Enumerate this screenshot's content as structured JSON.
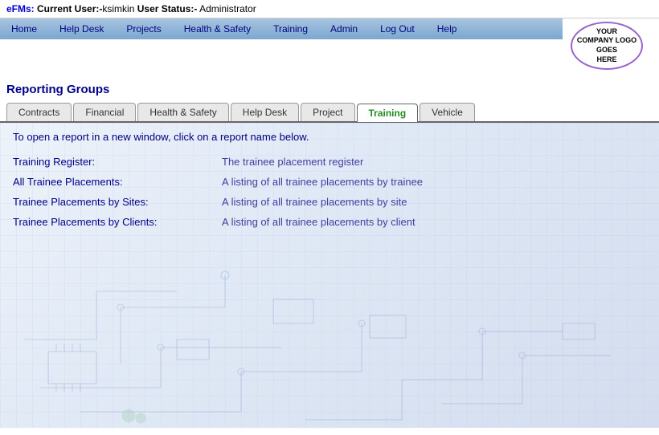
{
  "topbar": {
    "prefix": "eFMs:",
    "current_user_label": " Current User:-",
    "username": "ksimkin",
    "user_status_label": " User Status:-",
    "role": " Administrator"
  },
  "nav": {
    "items": [
      {
        "label": "Home",
        "href": "#"
      },
      {
        "label": "Help Desk",
        "href": "#"
      },
      {
        "label": "Projects",
        "href": "#"
      },
      {
        "label": "Health & Safety",
        "href": "#"
      },
      {
        "label": "Training",
        "href": "#"
      },
      {
        "label": "Admin",
        "href": "#"
      },
      {
        "label": "Log Out",
        "href": "#"
      },
      {
        "label": "Help",
        "href": "#"
      }
    ]
  },
  "logo": {
    "line1": "YOUR",
    "line2": "COMPANY LOGO",
    "line3": "GOES",
    "line4": "HERE"
  },
  "page": {
    "title": "Reporting Groups"
  },
  "tabs": [
    {
      "label": "Contracts",
      "active": false
    },
    {
      "label": "Financial",
      "active": false
    },
    {
      "label": "Health & Safety",
      "active": false
    },
    {
      "label": "Help Desk",
      "active": false
    },
    {
      "label": "Project",
      "active": false
    },
    {
      "label": "Training",
      "active": true
    },
    {
      "label": "Vehicle",
      "active": false
    }
  ],
  "content": {
    "instruction": "To open a report in a new window, click on a report name below.",
    "reports": [
      {
        "label": "Training Register:",
        "description": "The trainee placement register"
      },
      {
        "label": "All Trainee Placements:",
        "description": "A listing of all trainee placements by trainee"
      },
      {
        "label": "Trainee Placements by Sites:",
        "description": "A listing of all trainee placements by site"
      },
      {
        "label": "Trainee Placements by Clients:",
        "description": "A listing of all trainee placements by client"
      }
    ]
  }
}
